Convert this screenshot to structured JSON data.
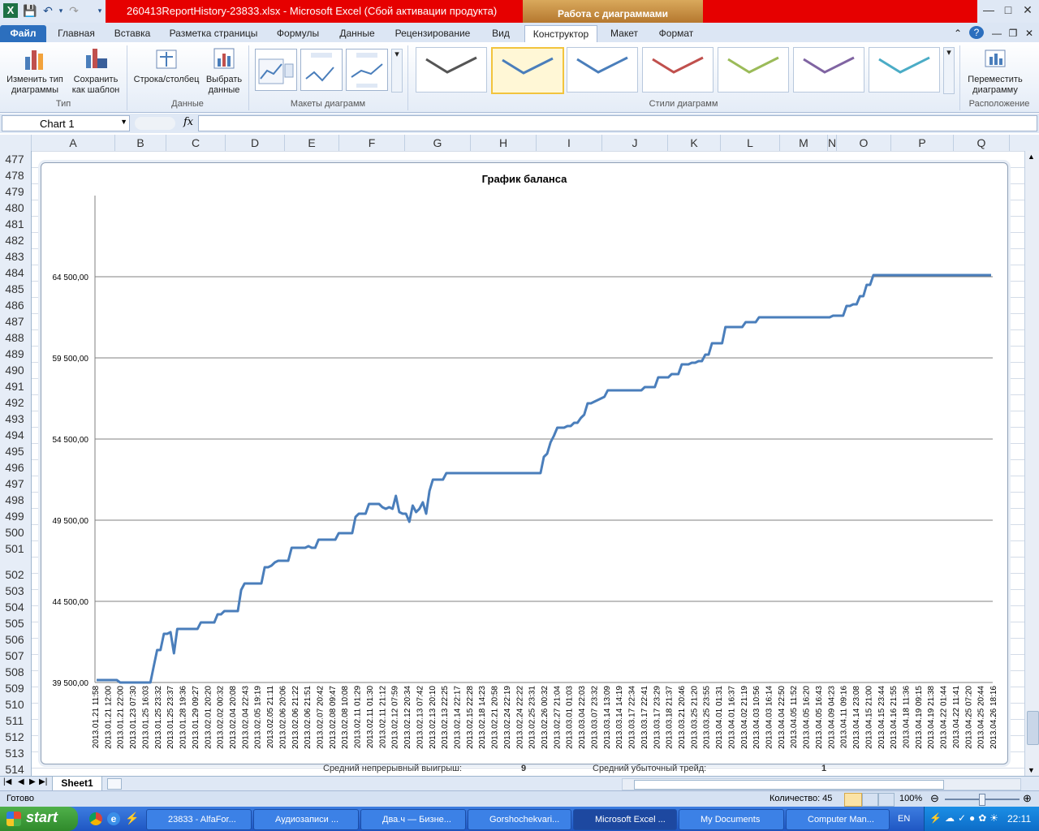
{
  "window": {
    "title": "260413ReportHistory-23833.xlsx  -  Microsoft Excel (Сбой активации продукта)",
    "context_tab_group": "Работа с диаграммами"
  },
  "ribbon": {
    "tabs": [
      "Файл",
      "Главная",
      "Вставка",
      "Разметка страницы",
      "Формулы",
      "Данные",
      "Рецензирование",
      "Вид",
      "Конструктор",
      "Макет",
      "Формат"
    ],
    "active_tab": "Конструктор",
    "groups": {
      "type": {
        "label": "Тип",
        "btn1_line1": "Изменить тип",
        "btn1_line2": "диаграммы",
        "btn2_line1": "Сохранить",
        "btn2_line2": "как шаблон"
      },
      "data": {
        "label": "Данные",
        "btn1": "Строка/столбец",
        "btn2_line1": "Выбрать",
        "btn2_line2": "данные"
      },
      "layouts": {
        "label": "Макеты диаграмм"
      },
      "styles": {
        "label": "Стили диаграмм",
        "colors": [
          "#555555",
          "#4a7ebb",
          "#4a7ebb",
          "#c0504d",
          "#9bbb59",
          "#8064a2",
          "#4bacc6"
        ]
      },
      "location": {
        "label": "Расположение",
        "btn_line1": "Переместить",
        "btn_line2": "диаграмму"
      }
    }
  },
  "formula_bar": {
    "name_box": "Chart 1",
    "fx": "fx",
    "value": ""
  },
  "columns": [
    "A",
    "B",
    "C",
    "D",
    "E",
    "F",
    "G",
    "H",
    "I",
    "J",
    "K",
    "L",
    "M",
    "N",
    "O",
    "P",
    "Q"
  ],
  "rows": [
    "477",
    "478",
    "479",
    "480",
    "481",
    "482",
    "483",
    "484",
    "485",
    "486",
    "487",
    "488",
    "489",
    "490",
    "491",
    "492",
    "493",
    "494",
    "495",
    "496",
    "497",
    "498",
    "499",
    "500",
    "501",
    "502",
    "503",
    "504",
    "505",
    "506",
    "507",
    "508",
    "509",
    "510",
    "511",
    "512",
    "513",
    "514"
  ],
  "below_chart": {
    "left_label": "Средний непрерывный выигрыш:",
    "left_value": "9",
    "right_label": "Средний убыточный трейд:",
    "right_value": "1"
  },
  "sheets": [
    "Sheet1"
  ],
  "status": {
    "ready": "Готово",
    "count": "Количество: 45",
    "zoom": "100%"
  },
  "taskbar": {
    "start": "start",
    "buttons": [
      "23833 - AlfaFor...",
      "Аудиозаписи ...",
      "Два.ч — Бизне...",
      "Gorshochekvari...",
      "Microsoft Excel ...",
      "My Documents",
      "Computer Man..."
    ],
    "lang": "EN",
    "clock": "22:11"
  },
  "chart_data": {
    "type": "line",
    "title": "График баланса",
    "xlabel": "",
    "ylabel": "",
    "ylim": [
      39500,
      69500
    ],
    "yticks": [
      "39 500,00",
      "44 500,00",
      "49 500,00",
      "54 500,00",
      "59 500,00",
      "64 500,00"
    ],
    "ytick_values": [
      39500,
      44500,
      49500,
      54500,
      59500,
      64500
    ],
    "grid": true,
    "categories": [
      "2013.01.21 11:58",
      "2013.01.21 12:00",
      "2013.01.21 22:00",
      "2013.01.23 07:30",
      "2013.01.25 16:03",
      "2013.01.25 23:32",
      "2013.01.25 23:37",
      "2013.01.28 19:36",
      "2013.01.29 09:27",
      "2013.02.01 20:20",
      "2013.02.02 00:32",
      "2013.02.04 20:08",
      "2013.02.04 22:43",
      "2013.02.05 19:19",
      "2013.02.05 21:11",
      "2013.02.06 20:06",
      "2013.02.06 21:22",
      "2013.02.06 21:51",
      "2013.02.07 20:42",
      "2013.02.08 09:47",
      "2013.02.08 10:08",
      "2013.02.11 01:29",
      "2013.02.11 01:30",
      "2013.02.11 21:12",
      "2013.02.12 07:59",
      "2013.02.12 20:34",
      "2013.02.13 07:42",
      "2013.02.13 20:10",
      "2013.02.13 22:25",
      "2013.02.14 22:17",
      "2013.02.15 22:28",
      "2013.02.18 14:23",
      "2013.02.21 20:58",
      "2013.02.24 22:19",
      "2013.02.24 22:22",
      "2013.02.25 23:31",
      "2013.02.26 00:32",
      "2013.02.27 21:04",
      "2013.03.01 01:03",
      "2013.03.04 22:03",
      "2013.03.07 23:32",
      "2013.03.14 13:09",
      "2013.03.14 14:19",
      "2013.03.17 22:34",
      "2013.03.17 22:41",
      "2013.03.17 23:29",
      "2013.03.18 21:37",
      "2013.03.21 20:46",
      "2013.03.25 21:20",
      "2013.03.25 23:55",
      "2013.04.01 01:31",
      "2013.04.01 16:37",
      "2013.04.02 21:19",
      "2013.04.03 10:56",
      "2013.04.03 16:14",
      "2013.04.04 22:50",
      "2013.04.05 11:52",
      "2013.04.05 16:20",
      "2013.04.05 16:43",
      "2013.04.09 04:23",
      "2013.04.11 09:16",
      "2013.04.14 23:08",
      "2013.04.15 21:00",
      "2013.04.15 23:44",
      "2013.04.16 21:55",
      "2013.04.18 11:36",
      "2013.04.19 09:15",
      "2013.04.19 21:38",
      "2013.04.22 01:44",
      "2013.04.22 11:41",
      "2013.04.25 07:20",
      "2013.04.25 20:44",
      "2013.04.26 18:16"
    ],
    "series": [
      {
        "color": "#4a7ebb",
        "values": [
          39650,
          39650,
          39650,
          39650,
          39650,
          39650,
          39650,
          39500,
          39500,
          39500,
          39500,
          39500,
          39500,
          39500,
          39500,
          39500,
          39500,
          40500,
          41500,
          41500,
          42500,
          42500,
          42600,
          41300,
          42800,
          42800,
          42800,
          42800,
          42800,
          42800,
          42800,
          43200,
          43200,
          43200,
          43200,
          43200,
          43700,
          43700,
          43900,
          43900,
          43900,
          43900,
          43900,
          45200,
          45600,
          45600,
          45600,
          45600,
          45600,
          45600,
          46600,
          46600,
          46700,
          46900,
          47000,
          47000,
          47000,
          47000,
          47800,
          47800,
          47800,
          47800,
          47800,
          47900,
          47800,
          47800,
          48300,
          48300,
          48300,
          48300,
          48300,
          48300,
          48700,
          48700,
          48700,
          48700,
          48700,
          49700,
          49900,
          49900,
          49900,
          50500,
          50500,
          50500,
          50500,
          50300,
          50200,
          50300,
          50200,
          51000,
          50000,
          49900,
          49900,
          49400,
          50400,
          50000,
          50200,
          50600,
          49900,
          51300,
          52000,
          52000,
          52000,
          52000,
          52400,
          52400,
          52400,
          52400,
          52400,
          52400,
          52400,
          52400,
          52400,
          52400,
          52400,
          52400,
          52400,
          52400,
          52400,
          52400,
          52400,
          52400,
          52400,
          52400,
          52400,
          52400,
          52400,
          52400,
          52400,
          52400,
          52400,
          52400,
          52400,
          53400,
          53600,
          54300,
          54700,
          55200,
          55200,
          55200,
          55300,
          55300,
          55500,
          55500,
          55800,
          56000,
          56700,
          56700,
          56800,
          56900,
          57000,
          57100,
          57500,
          57500,
          57500,
          57500,
          57500,
          57500,
          57500,
          57500,
          57500,
          57500,
          57500,
          57700,
          57700,
          57700,
          57700,
          58300,
          58300,
          58300,
          58300,
          58500,
          58500,
          58500,
          59100,
          59100,
          59100,
          59200,
          59200,
          59300,
          59300,
          59700,
          59700,
          60400,
          60400,
          60400,
          60400,
          61400,
          61400,
          61400,
          61400,
          61400,
          61400,
          61700,
          61700,
          61700,
          61700,
          62000,
          62000,
          62000,
          62000,
          62000,
          62000,
          62000,
          62000,
          62000,
          62000,
          62000,
          62000,
          62000,
          62000,
          62000,
          62000,
          62000,
          62000,
          62000,
          62000,
          62000,
          62000,
          62100,
          62100,
          62100,
          62100,
          62700,
          62700,
          62800,
          62800,
          63300,
          63300,
          64000,
          64000,
          64600,
          64600,
          64600,
          64600,
          64600,
          64600,
          64600,
          64600,
          64600,
          64600,
          64600,
          64600,
          64600,
          64600,
          64600,
          64600,
          64600,
          64600,
          64600,
          64600,
          64600,
          64600,
          64600,
          64600,
          64600,
          64600,
          64600,
          64600,
          64600,
          64600,
          64600,
          64600,
          64600,
          64600,
          64600,
          64600
        ]
      }
    ]
  }
}
